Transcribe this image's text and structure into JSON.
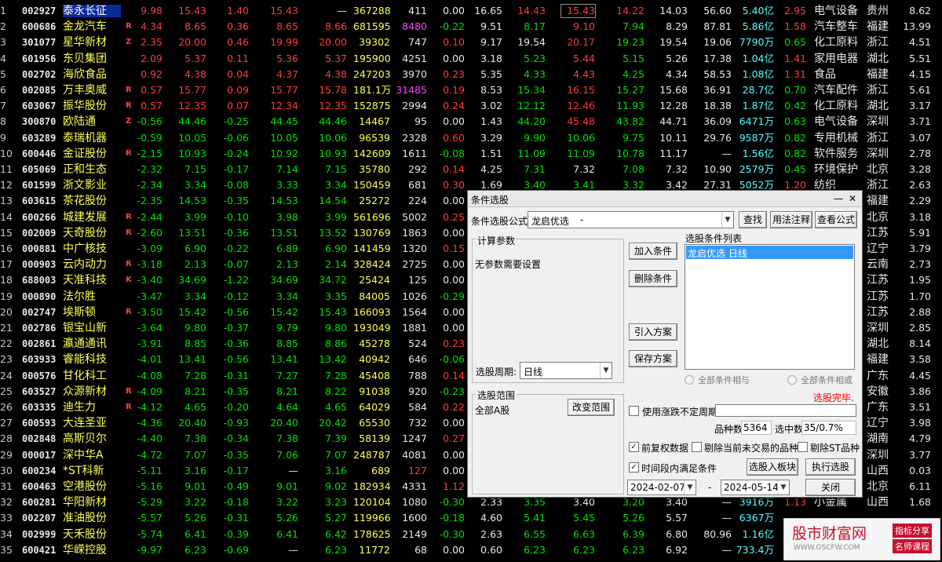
{
  "rows": [
    {
      "idx": "1",
      "code": "002927",
      "name": "泰永长征",
      "flag": "",
      "pct": "9.98",
      "price": "15.43",
      "chg": "1.40",
      "bid": "15.43",
      "ask": "—",
      "vol": "367288",
      "cur": "411",
      "spd": "0.00",
      "turn": "16.65",
      "open": "14.43",
      "high": "15.43",
      "low": "14.22",
      "prev": "14.03",
      "pe": "56.60",
      "amt": "5.40亿",
      "vr": "2.95",
      "ind": "电气设备",
      "reg": "贵州",
      "last": "8.62"
    },
    {
      "idx": "2",
      "code": "600686",
      "name": "金龙汽车",
      "flag": "R",
      "pct": "4.34",
      "price": "8.65",
      "chg": "0.36",
      "bid": "8.65",
      "ask": "8.66",
      "vol": "681595",
      "cur": "8480",
      "spd": "-0.22",
      "turn": "9.51",
      "open": "8.17",
      "high": "9.10",
      "low": "7.94",
      "prev": "8.29",
      "pe": "87.81",
      "amt": "5.86亿",
      "vr": "1.58",
      "ind": "汽车整车",
      "reg": "福建",
      "last": "13.99"
    },
    {
      "idx": "3",
      "code": "301077",
      "name": "星华新材",
      "flag": "Z",
      "pct": "2.35",
      "price": "20.00",
      "chg": "0.46",
      "bid": "19.99",
      "ask": "20.00",
      "vol": "39302",
      "cur": "747",
      "spd": "0.10",
      "turn": "9.17",
      "open": "19.54",
      "high": "20.17",
      "low": "19.23",
      "prev": "19.54",
      "pe": "19.06",
      "amt": "7790万",
      "vr": "0.65",
      "ind": "化工原料",
      "reg": "浙江",
      "last": "4.51"
    },
    {
      "idx": "4",
      "code": "601956",
      "name": "东贝集团",
      "flag": "",
      "pct": "2.09",
      "price": "5.37",
      "chg": "0.11",
      "bid": "5.36",
      "ask": "5.37",
      "vol": "195900",
      "cur": "4251",
      "spd": "0.00",
      "turn": "3.18",
      "open": "5.23",
      "high": "5.44",
      "low": "5.15",
      "prev": "5.26",
      "pe": "17.38",
      "amt": "1.04亿",
      "vr": "1.41",
      "ind": "家用电器",
      "reg": "湖北",
      "last": "5.51"
    },
    {
      "idx": "5",
      "code": "002702",
      "name": "海欣食品",
      "flag": "",
      "pct": "0.92",
      "price": "4.38",
      "chg": "0.04",
      "bid": "4.37",
      "ask": "4.38",
      "vol": "247203",
      "cur": "3970",
      "spd": "0.23",
      "turn": "5.35",
      "open": "4.33",
      "high": "4.43",
      "low": "4.25",
      "prev": "4.34",
      "pe": "58.53",
      "amt": "1.08亿",
      "vr": "1.31",
      "ind": "食品",
      "reg": "福建",
      "last": "4.15"
    },
    {
      "idx": "6",
      "code": "002085",
      "name": "万丰奥威",
      "flag": "R",
      "pct": "0.57",
      "price": "15.77",
      "chg": "0.09",
      "bid": "15.77",
      "ask": "15.78",
      "vol": "181.1万",
      "cur": "31485",
      "spd": "0.19",
      "turn": "8.53",
      "open": "15.34",
      "high": "16.15",
      "low": "15.27",
      "prev": "15.68",
      "pe": "36.91",
      "amt": "28.7亿",
      "vr": "0.70",
      "ind": "汽车配件",
      "reg": "浙江",
      "last": "5.61"
    },
    {
      "idx": "7",
      "code": "603067",
      "name": "振华股份",
      "flag": "R",
      "pct": "0.57",
      "price": "12.35",
      "chg": "0.07",
      "bid": "12.34",
      "ask": "12.35",
      "vol": "152875",
      "cur": "2994",
      "spd": "0.24",
      "turn": "3.02",
      "open": "12.12",
      "high": "12.46",
      "low": "11.93",
      "prev": "12.28",
      "pe": "18.38",
      "amt": "1.87亿",
      "vr": "0.42",
      "ind": "化工原料",
      "reg": "湖北",
      "last": "3.17"
    },
    {
      "idx": "8",
      "code": "300870",
      "name": "欧陆通",
      "flag": "Z",
      "pct": "-0.56",
      "price": "44.46",
      "chg": "-0.25",
      "bid": "44.45",
      "ask": "44.46",
      "vol": "14467",
      "cur": "95",
      "spd": "0.00",
      "turn": "1.43",
      "open": "44.20",
      "high": "45.48",
      "low": "43.82",
      "prev": "44.71",
      "pe": "36.09",
      "amt": "6471万",
      "vr": "0.63",
      "ind": "电气设备",
      "reg": "深圳",
      "last": "3.71"
    },
    {
      "idx": "9",
      "code": "603289",
      "name": "泰瑞机器",
      "flag": "",
      "pct": "-0.59",
      "price": "10.05",
      "chg": "-0.06",
      "bid": "10.05",
      "ask": "10.06",
      "vol": "96539",
      "cur": "2328",
      "spd": "0.60",
      "turn": "3.29",
      "open": "9.90",
      "high": "10.06",
      "low": "9.75",
      "prev": "10.11",
      "pe": "29.76",
      "amt": "9587万",
      "vr": "0.82",
      "ind": "专用机械",
      "reg": "浙江",
      "last": "3.07"
    },
    {
      "idx": "10",
      "code": "600446",
      "name": "金证股份",
      "flag": "R",
      "pct": "-2.15",
      "price": "10.93",
      "chg": "-0.24",
      "bid": "10.92",
      "ask": "10.93",
      "vol": "142609",
      "cur": "1611",
      "spd": "-0.08",
      "turn": "1.51",
      "open": "11.09",
      "high": "11.09",
      "low": "10.78",
      "prev": "11.17",
      "pe": "—",
      "amt": "1.56亿",
      "vr": "0.82",
      "ind": "软件服务",
      "reg": "深圳",
      "last": "2.78"
    },
    {
      "idx": "11",
      "code": "605069",
      "name": "正和生态",
      "flag": "",
      "pct": "-2.32",
      "price": "7.15",
      "chg": "-0.17",
      "bid": "7.14",
      "ask": "7.15",
      "vol": "35780",
      "cur": "292",
      "spd": "0.14",
      "turn": "4.25",
      "open": "7.31",
      "high": "7.32",
      "low": "7.08",
      "prev": "7.32",
      "pe": "10.90",
      "amt": "2579万",
      "vr": "0.45",
      "ind": "环境保护",
      "reg": "北京",
      "last": "3.28"
    },
    {
      "idx": "12",
      "code": "601599",
      "name": "浙文影业",
      "flag": "",
      "pct": "-2.34",
      "price": "3.34",
      "chg": "-0.08",
      "bid": "3.33",
      "ask": "3.34",
      "vol": "150459",
      "cur": "681",
      "spd": "0.30",
      "turn": "1.69",
      "open": "3.40",
      "high": "3.41",
      "low": "3.32",
      "prev": "3.42",
      "pe": "27.31",
      "amt": "5052万",
      "vr": "1.20",
      "ind": "纺织",
      "reg": "浙江",
      "last": "2.63"
    },
    {
      "idx": "13",
      "code": "603615",
      "name": "茶花股份",
      "flag": "",
      "pct": "-2.35",
      "price": "14.53",
      "chg": "-0.35",
      "bid": "14.53",
      "ask": "14.54",
      "vol": "25272",
      "cur": "224",
      "spd": "0.00",
      "turn": "",
      "open": "",
      "high": "",
      "low": "",
      "prev": "",
      "pe": "",
      "amt": "",
      "vr": "",
      "ind": "",
      "reg": "福建",
      "last": "2.29"
    },
    {
      "idx": "14",
      "code": "600266",
      "name": "城建发展",
      "flag": "R",
      "pct": "-2.44",
      "price": "3.99",
      "chg": "-0.10",
      "bid": "3.98",
      "ask": "3.99",
      "vol": "561696",
      "cur": "5002",
      "spd": "0.25",
      "turn": "",
      "open": "",
      "high": "",
      "low": "",
      "prev": "",
      "pe": "",
      "amt": "",
      "vr": "",
      "ind": "",
      "reg": "北京",
      "last": "3.18"
    },
    {
      "idx": "15",
      "code": "002009",
      "name": "天奇股份",
      "flag": "R",
      "pct": "-2.60",
      "price": "13.51",
      "chg": "-0.36",
      "bid": "13.51",
      "ask": "13.52",
      "vol": "130769",
      "cur": "1863",
      "spd": "0.00",
      "turn": "",
      "open": "",
      "high": "",
      "low": "",
      "prev": "",
      "pe": "",
      "amt": "",
      "vr": "",
      "ind": "",
      "reg": "江苏",
      "last": "5.91"
    },
    {
      "idx": "16",
      "code": "000881",
      "name": "中广核技",
      "flag": "",
      "pct": "-3.09",
      "price": "6.90",
      "chg": "-0.22",
      "bid": "6.89",
      "ask": "6.90",
      "vol": "141459",
      "cur": "1320",
      "spd": "0.15",
      "turn": "",
      "open": "",
      "high": "",
      "low": "",
      "prev": "",
      "pe": "",
      "amt": "",
      "vr": "",
      "ind": "",
      "reg": "辽宁",
      "last": "3.79"
    },
    {
      "idx": "17",
      "code": "000903",
      "name": "云内动力",
      "flag": "R",
      "pct": "-3.18",
      "price": "2.13",
      "chg": "-0.07",
      "bid": "2.13",
      "ask": "2.14",
      "vol": "328424",
      "cur": "2725",
      "spd": "0.00",
      "turn": "",
      "open": "",
      "high": "",
      "low": "",
      "prev": "",
      "pe": "",
      "amt": "",
      "vr": "",
      "ind": "",
      "reg": "云南",
      "last": "2.73"
    },
    {
      "idx": "18",
      "code": "688003",
      "name": "天准科技",
      "flag": "K",
      "pct": "-3.40",
      "price": "34.69",
      "chg": "-1.22",
      "bid": "34.69",
      "ask": "34.72",
      "vol": "25424",
      "cur": "125",
      "spd": "0.00",
      "turn": "",
      "open": "",
      "high": "",
      "low": "",
      "prev": "",
      "pe": "",
      "amt": "",
      "vr": "",
      "ind": "",
      "reg": "江苏",
      "last": "1.95"
    },
    {
      "idx": "19",
      "code": "000890",
      "name": "法尔胜",
      "flag": "",
      "pct": "-3.47",
      "price": "3.34",
      "chg": "-0.12",
      "bid": "3.34",
      "ask": "3.35",
      "vol": "84005",
      "cur": "1026",
      "spd": "-0.29",
      "turn": "",
      "open": "",
      "high": "",
      "low": "",
      "prev": "",
      "pe": "",
      "amt": "",
      "vr": "",
      "ind": "",
      "reg": "江苏",
      "last": "1.70"
    },
    {
      "idx": "20",
      "code": "002747",
      "name": "埃斯顿",
      "flag": "R",
      "pct": "-3.50",
      "price": "15.42",
      "chg": "-0.56",
      "bid": "15.42",
      "ask": "15.43",
      "vol": "166093",
      "cur": "1564",
      "spd": "0.00",
      "turn": "",
      "open": "",
      "high": "",
      "low": "",
      "prev": "",
      "pe": "",
      "amt": "",
      "vr": "",
      "ind": "",
      "reg": "江苏",
      "last": "2.88"
    },
    {
      "idx": "21",
      "code": "002786",
      "name": "银宝山新",
      "flag": "",
      "pct": "-3.64",
      "price": "9.80",
      "chg": "-0.37",
      "bid": "9.79",
      "ask": "9.80",
      "vol": "193049",
      "cur": "1881",
      "spd": "0.00",
      "turn": "",
      "open": "",
      "high": "",
      "low": "",
      "prev": "",
      "pe": "",
      "amt": "",
      "vr": "",
      "ind": "",
      "reg": "深圳",
      "last": "2.85"
    },
    {
      "idx": "22",
      "code": "002861",
      "name": "瀛通通讯",
      "flag": "",
      "pct": "-3.91",
      "price": "8.85",
      "chg": "-0.36",
      "bid": "8.85",
      "ask": "8.86",
      "vol": "45278",
      "cur": "524",
      "spd": "0.23",
      "turn": "",
      "open": "",
      "high": "",
      "low": "",
      "prev": "",
      "pe": "",
      "amt": "",
      "vr": "",
      "ind": "",
      "reg": "湖北",
      "last": "8.14"
    },
    {
      "idx": "23",
      "code": "603933",
      "name": "睿能科技",
      "flag": "",
      "pct": "-4.01",
      "price": "13.41",
      "chg": "-0.56",
      "bid": "13.41",
      "ask": "13.42",
      "vol": "40942",
      "cur": "646",
      "spd": "-0.06",
      "turn": "",
      "open": "",
      "high": "",
      "low": "",
      "prev": "",
      "pe": "",
      "amt": "",
      "vr": "",
      "ind": "",
      "reg": "福建",
      "last": "3.58"
    },
    {
      "idx": "24",
      "code": "000576",
      "name": "甘化科工",
      "flag": "",
      "pct": "-4.08",
      "price": "7.28",
      "chg": "-0.31",
      "bid": "7.27",
      "ask": "7.28",
      "vol": "45408",
      "cur": "788",
      "spd": "0.14",
      "turn": "",
      "open": "",
      "high": "",
      "low": "",
      "prev": "",
      "pe": "",
      "amt": "",
      "vr": "",
      "ind": "",
      "reg": "广东",
      "last": "4.45"
    },
    {
      "idx": "25",
      "code": "603527",
      "name": "众源新材",
      "flag": "R",
      "pct": "-4.09",
      "price": "8.21",
      "chg": "-0.35",
      "bid": "8.21",
      "ask": "8.22",
      "vol": "91038",
      "cur": "920",
      "spd": "-0.23",
      "turn": "",
      "open": "",
      "high": "",
      "low": "",
      "prev": "",
      "pe": "",
      "amt": "",
      "vr": "",
      "ind": "",
      "reg": "安徽",
      "last": "3.86"
    },
    {
      "idx": "26",
      "code": "603335",
      "name": "迪生力",
      "flag": "R",
      "pct": "-4.12",
      "price": "4.65",
      "chg": "-0.20",
      "bid": "4.64",
      "ask": "4.65",
      "vol": "64029",
      "cur": "584",
      "spd": "0.22",
      "turn": "",
      "open": "",
      "high": "",
      "low": "",
      "prev": "",
      "pe": "",
      "amt": "",
      "vr": "",
      "ind": "",
      "reg": "广东",
      "last": "3.51"
    },
    {
      "idx": "27",
      "code": "600593",
      "name": "大连圣亚",
      "flag": "",
      "pct": "-4.36",
      "price": "20.40",
      "chg": "-0.93",
      "bid": "20.40",
      "ask": "20.42",
      "vol": "65530",
      "cur": "732",
      "spd": "0.00",
      "turn": "",
      "open": "",
      "high": "",
      "low": "",
      "prev": "",
      "pe": "",
      "amt": "",
      "vr": "",
      "ind": "",
      "reg": "辽宁",
      "last": "3.98"
    },
    {
      "idx": "28",
      "code": "002848",
      "name": "高斯贝尔",
      "flag": "",
      "pct": "-4.40",
      "price": "7.38",
      "chg": "-0.34",
      "bid": "7.38",
      "ask": "7.39",
      "vol": "58139",
      "cur": "1247",
      "spd": "0.27",
      "turn": "",
      "open": "",
      "high": "",
      "low": "",
      "prev": "",
      "pe": "",
      "amt": "",
      "vr": "",
      "ind": "",
      "reg": "湖南",
      "last": "4.79"
    },
    {
      "idx": "29",
      "code": "000017",
      "name": "深中华A",
      "flag": "",
      "pct": "-4.72",
      "price": "7.07",
      "chg": "-0.35",
      "bid": "7.06",
      "ask": "7.07",
      "vol": "248787",
      "cur": "4081",
      "spd": "0.00",
      "turn": "",
      "open": "",
      "high": "",
      "low": "",
      "prev": "",
      "pe": "",
      "amt": "",
      "vr": "",
      "ind": "",
      "reg": "深圳",
      "last": "3.77"
    },
    {
      "idx": "30",
      "code": "600234",
      "name": "*ST科新",
      "flag": "",
      "pct": "-5.11",
      "price": "3.16",
      "chg": "-0.17",
      "bid": "—",
      "ask": "3.16",
      "vol": "689",
      "cur": "127",
      "spd": "0.00",
      "turn": "",
      "open": "",
      "high": "",
      "low": "",
      "prev": "",
      "pe": "",
      "amt": "",
      "vr": "",
      "ind": "",
      "reg": "山西",
      "last": "0.03"
    },
    {
      "idx": "31",
      "code": "600463",
      "name": "空港股份",
      "flag": "",
      "pct": "-5.16",
      "price": "9.01",
      "chg": "-0.49",
      "bid": "9.01",
      "ask": "9.02",
      "vol": "182934",
      "cur": "4331",
      "spd": "1.12",
      "turn": "",
      "open": "",
      "high": "",
      "low": "",
      "prev": "",
      "pe": "",
      "amt": "",
      "vr": "",
      "ind": "",
      "reg": "北京",
      "last": "6.11"
    },
    {
      "idx": "32",
      "code": "600281",
      "name": "华阳新材",
      "flag": "",
      "pct": "-5.29",
      "price": "3.22",
      "chg": "-0.18",
      "bid": "3.22",
      "ask": "3.23",
      "vol": "120104",
      "cur": "1080",
      "spd": "-0.30",
      "turn": "2.33",
      "open": "3.35",
      "high": "3.40",
      "low": "3.20",
      "prev": "3.40",
      "pe": "—",
      "amt": "3916万",
      "vr": "1.13",
      "ind": "小金属",
      "reg": "山西",
      "last": "1.68"
    },
    {
      "idx": "33",
      "code": "002207",
      "name": "准油股份",
      "flag": "",
      "pct": "-5.57",
      "price": "5.26",
      "chg": "-0.31",
      "bid": "5.26",
      "ask": "5.27",
      "vol": "119966",
      "cur": "1600",
      "spd": "-0.18",
      "turn": "4.60",
      "open": "5.41",
      "high": "5.45",
      "low": "5.26",
      "prev": "5.57",
      "pe": "—",
      "amt": "6367万",
      "vr": "",
      "ind": "",
      "reg": "",
      "last": ""
    },
    {
      "idx": "34",
      "code": "002999",
      "name": "天禾股份",
      "flag": "",
      "pct": "-5.74",
      "price": "6.41",
      "chg": "-0.39",
      "bid": "6.41",
      "ask": "6.42",
      "vol": "178625",
      "cur": "2149",
      "spd": "-0.30",
      "turn": "2.63",
      "open": "6.55",
      "high": "6.63",
      "low": "6.39",
      "prev": "6.80",
      "pe": "80.96",
      "amt": "1.16亿",
      "vr": "",
      "ind": "",
      "reg": "",
      "last": ""
    },
    {
      "idx": "35",
      "code": "600421",
      "name": "华嵘控股",
      "flag": "",
      "pct": "-9.97",
      "price": "6.23",
      "chg": "-0.69",
      "bid": "—",
      "ask": "6.23",
      "vol": "11772",
      "cur": "68",
      "spd": "0.00",
      "turn": "0.60",
      "open": "6.23",
      "high": "6.23",
      "low": "6.23",
      "prev": "6.92",
      "pe": "—",
      "amt": "733.4万",
      "vr": "",
      "ind": "",
      "reg": "",
      "last": ""
    }
  ],
  "dialog": {
    "title": "条件选股",
    "formula_label": "条件选股公式",
    "formula_value": "龙启优选",
    "formula_suffix": "-",
    "btn_find": "查找",
    "btn_usage": "用法注释",
    "btn_view": "查看公式",
    "params_group": "计算参数",
    "params_note": "无参数需要设置",
    "btn_add": "加入条件",
    "btn_delete": "删除条件",
    "btn_import": "引入方案",
    "btn_save": "保存方案",
    "list_title": "选股条件列表",
    "list_items": [
      "龙启优选  日线"
    ],
    "period_label": "选股周期:",
    "period_value": "日线",
    "radio_and": "全部条件相与",
    "radio_or": "全部条件相或",
    "status": "选股完毕.",
    "range_group": "选股范围",
    "range_value": "全部A股",
    "btn_change_range": "改变范围",
    "chk_uncertain": "使用涨跌不定周期",
    "count_label": "品种数",
    "count_value": "5364",
    "selected_label": "选中数",
    "selected_value": "35/0.7%",
    "chk_adjust": "前复权数据",
    "chk_exclude_untraded": "剔除当前未交易的品种",
    "chk_exclude_st": "剔除ST品种",
    "chk_time": "时间段内满足条件",
    "btn_to_board": "选股入板块",
    "btn_execute": "执行选股",
    "date_from": "2024-02-07",
    "date_sep": "-",
    "date_to": "2024-05-14",
    "btn_close": "关闭"
  },
  "watermark": {
    "site_name": "股市财富网",
    "badge1": "指标分享",
    "badge2": "名师课程",
    "url": "WWW.GSCFW.COM"
  },
  "colors": {
    "up": "#ff3b3b",
    "down": "#00e000",
    "selected_row": "#0a2a9a",
    "dialog_bg": "#f0f0f0",
    "status_red": "#ff0000"
  }
}
